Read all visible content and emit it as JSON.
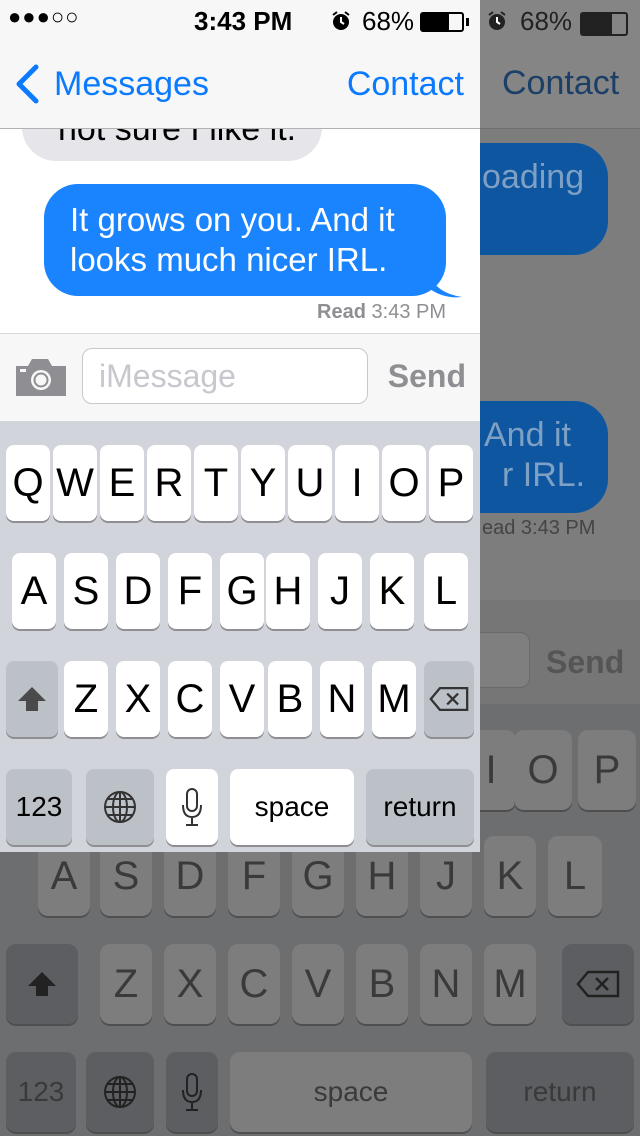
{
  "status_bar": {
    "signal": "●●●○○",
    "time": "3:43 PM",
    "alarm_icon": "alarm-clock-icon",
    "battery_percent": "68%",
    "battery_level": 0.68
  },
  "nav": {
    "back_label": "Messages",
    "contact_label": "Contact"
  },
  "conversation": {
    "incoming_partial": "not sure I like it.",
    "outgoing_message": "It grows on you. And it looks much nicer IRL.",
    "read_label": "Read",
    "read_time": "3:43 PM"
  },
  "composer": {
    "placeholder": "iMessage",
    "send_label": "Send",
    "camera_icon": "camera-icon"
  },
  "keyboard": {
    "row1": [
      "Q",
      "W",
      "E",
      "R",
      "T",
      "Y",
      "U",
      "I",
      "O",
      "P"
    ],
    "row2": [
      "A",
      "S",
      "D",
      "F",
      "G",
      "H",
      "J",
      "K",
      "L"
    ],
    "row3": [
      "Z",
      "X",
      "C",
      "V",
      "B",
      "N",
      "M"
    ],
    "numbers_label": "123",
    "space_label": "space",
    "return_label": "return",
    "shift_icon": "shift-icon",
    "delete_icon": "backspace-icon",
    "globe_icon": "globe-icon",
    "mic_icon": "microphone-icon"
  },
  "background_screen": {
    "status_time": "68%",
    "contact_label": "Contact",
    "bubble_fragment_1": "oading",
    "bubble_fragment_2a": "And it",
    "bubble_fragment_2b": "r IRL.",
    "read_fragment": "ead 3:43 PM",
    "send_label": "Send",
    "row1_visible": [
      "I",
      "O",
      "P"
    ],
    "row2": [
      "A",
      "S",
      "D",
      "F",
      "G",
      "H",
      "J",
      "K",
      "L"
    ],
    "row3": [
      "Z",
      "X",
      "C",
      "V",
      "B",
      "N",
      "M"
    ],
    "numbers_label": "123",
    "space_label": "space",
    "return_label": "return"
  },
  "colors": {
    "accent": "#0a7aff",
    "outgoing_bubble": "#1a84ff",
    "incoming_bubble": "#e5e5ea",
    "keyboard_bg": "#d1d5db",
    "dimmed_bg": "#7a7a7a"
  }
}
